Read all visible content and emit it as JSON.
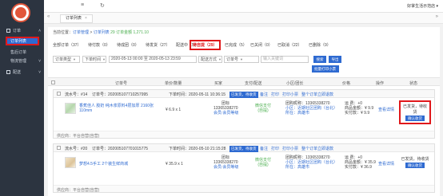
{
  "sidebar": {
    "group_order": "订单",
    "items": [
      "订单列表",
      "售后订单",
      "物流管理"
    ],
    "group_distribution": "配送"
  },
  "topbar": {
    "shop_name": "好掌生活示范店 ▾",
    "tab_label": "订单列表"
  },
  "breadcrumb": {
    "prefix": "当前位置：",
    "level1": "订单管理",
    "level2": "订单列表",
    "summary": "29 订单金额 1,271.10"
  },
  "statuses": [
    "全部订单（37）",
    "待付款（0）",
    "待成团（0）",
    "待发货（27）",
    "配送中（5）",
    "待自提（29）",
    "已完成（5）",
    "已关闭（0）",
    "已取消（22）",
    "已删除（9）"
  ],
  "filters": {
    "type": "订单类型",
    "time": "下单时间",
    "date_range": "2020-05-13 00:00 至 2020-05-13 23:59",
    "delivery": "配送方式",
    "order_no": "订单号",
    "search_placeholder": "输入关键词",
    "btn_search": "搜索",
    "btn_export": "导出",
    "btn_batch_print": "批量打印小票"
  },
  "table_header": {
    "order_no": "订单号",
    "unit_qty": "单价/数量",
    "buyer": "买家",
    "payment": "支付/配送",
    "community": "小区/团长",
    "price": "价格",
    "operation": "操作",
    "status": "状态"
  },
  "orders": [
    {
      "seq": "流水号：#14",
      "order_no": "订单号：202005107710257995",
      "time": "下单时间：2020-05-11 10:36:15",
      "tag1": "已发货，待收货",
      "links": [
        "备注",
        "打印",
        "打印小票",
        "整个订单立即退款"
      ],
      "product": "香蕉佳人 胶奶 纯木浆原料4层加厚 2160张 110mm",
      "unit": "¥ 6.9 x 1",
      "buyer_lines": [
        "团标",
        "13365338270",
        "会员:会员等级"
      ],
      "payment_lines": [
        "微信支付",
        "(自提)"
      ],
      "community_lines": [
        "团购昵称：13365338270",
        "小区：近期社区团购（台北）",
        "所在：高雄市"
      ],
      "price_lines": [
        "运 费：+0",
        "商品金额：¥ 9.9",
        "实付款：¥ 9.9"
      ],
      "op": "查看详情",
      "status_text": "已发货，待收货",
      "status_btn": "确认收货",
      "footer": "供应商：平台自营(自营)"
    },
    {
      "seq": "流水号：#20",
      "order_no": "订单号：202005107701015775",
      "time": "下单时间：2020-05-10 21:15:28",
      "tag1": "已发货，待收货",
      "links": [
        "备注",
        "打印",
        "打印小票",
        "整个订单立即退款"
      ],
      "product": "梦想4.5手工 2个装生鲜商城",
      "unit": "¥ 35.9 x 1",
      "buyer_lines": [
        "团标",
        "13365338270",
        "会员:会员等级"
      ],
      "payment_lines": [
        "微信支付",
        "(自提)"
      ],
      "community_lines": [
        "团购昵称：13365338270",
        "小区：近期社区团购（台北）",
        "所在：高雄市"
      ],
      "price_lines": [
        "运 费：+0",
        "商品金额：¥ 35.9",
        "实付款：¥ 36.9"
      ],
      "op": "查看详情",
      "status_text": "已发货，待收货",
      "status_btn": "确认收货",
      "footer": "供应商：平台自营(自营)"
    }
  ],
  "colors": {
    "sidebar_bg": "#2c3440",
    "accent": "#2e6ad1",
    "highlight": "#e0181b"
  }
}
